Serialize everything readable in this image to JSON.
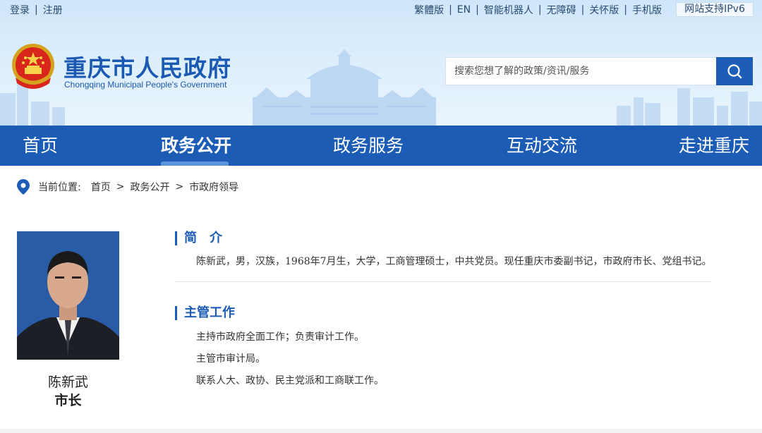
{
  "topbar": {
    "login": "登录",
    "register": "注册",
    "links": [
      "繁體版",
      "EN",
      "智能机器人",
      "无障碍",
      "关怀版",
      "手机版"
    ],
    "ipv6": "网站支持IPv6"
  },
  "site": {
    "title": "重庆市人民政府",
    "subtitle": "Chongqing Municipal People's Government"
  },
  "search": {
    "placeholder": "搜索您想了解的政策/资讯/服务"
  },
  "nav": {
    "items": [
      "首页",
      "政务公开",
      "政务服务",
      "互动交流",
      "走进重庆"
    ],
    "active": "政务公开"
  },
  "breadcrumb": {
    "label": "当前位置:",
    "items": [
      "首页",
      "政务公开",
      "市政府领导"
    ],
    "separator": ">"
  },
  "profile": {
    "name": "陈新武",
    "position": "市长",
    "intro_heading": "简　介",
    "intro": "陈新武，男，汉族，1968年7月生，大学，工商管理硕士，中共党员。现任重庆市委副书记，市政府市长、党组书记。",
    "duties_heading": "主管工作",
    "duties": [
      "主持市政府全面工作；负责审计工作。",
      "主管市审计局。",
      "联系人大、政协、民主党派和工商联工作。"
    ]
  },
  "colors": {
    "primary": "#1c5cb5",
    "header_bg": "#d6eafb",
    "text": "#333333"
  },
  "icons": {
    "search": "search-icon",
    "location": "location-pin-icon",
    "emblem": "national-emblem-icon"
  }
}
